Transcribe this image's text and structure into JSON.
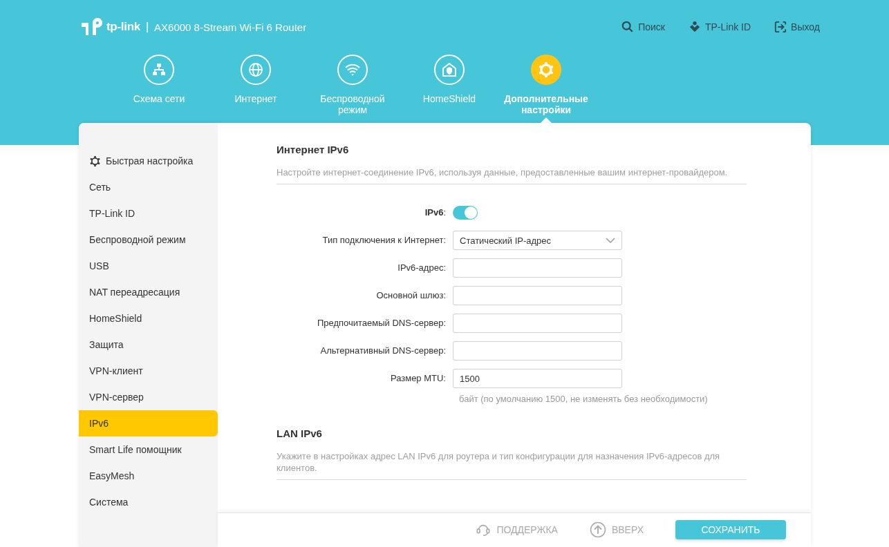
{
  "header": {
    "brand": "tp-link",
    "separator": "|",
    "product": "AX6000 8-Stream Wi-Fi 6 Router",
    "top_links": [
      {
        "label": "Поиск"
      },
      {
        "label": "TP-Link ID"
      },
      {
        "label": "Выход"
      }
    ],
    "nav": [
      {
        "label": "Схема сети",
        "selected": false
      },
      {
        "label": "Интернет",
        "selected": false
      },
      {
        "label": "Беспроводной режим",
        "selected": false
      },
      {
        "label": "HomeShield",
        "selected": false
      },
      {
        "label": "Дополнительные настройки",
        "selected": true
      }
    ]
  },
  "sidebar": {
    "items": [
      {
        "label": "Быстрая настройка",
        "selected": false
      },
      {
        "label": "Сеть",
        "selected": false
      },
      {
        "label": "TP-Link ID",
        "selected": false
      },
      {
        "label": "Беспроводной режим",
        "selected": false
      },
      {
        "label": "USB",
        "selected": false
      },
      {
        "label": "NAT переадресация",
        "selected": false
      },
      {
        "label": "HomeShield",
        "selected": false
      },
      {
        "label": "Защита",
        "selected": false
      },
      {
        "label": "VPN-клиент",
        "selected": false
      },
      {
        "label": "VPN-сервер",
        "selected": false
      },
      {
        "label": "IPv6",
        "selected": true
      },
      {
        "label": "Smart Life помощник",
        "selected": false
      },
      {
        "label": "EasyMesh",
        "selected": false
      },
      {
        "label": "Система",
        "selected": false
      }
    ]
  },
  "sections": [
    {
      "title": "Интернет IPv6",
      "description": "Настройте интернет-соединение IPv6, используя данные, предоставленные вашим интернет-провайдером.",
      "fields": [
        {
          "kind": "toggle",
          "label": "**IPv6**:",
          "on": true
        },
        {
          "kind": "select",
          "label": "Тип подключения к Интернет:",
          "value": "Статический IP-адрес"
        },
        {
          "kind": "input",
          "label": "IPv6-адрес:"
        },
        {
          "kind": "input",
          "label": "Основной шлюз:"
        },
        {
          "kind": "input",
          "label": "Предпочитаемый DNS-сервер:"
        },
        {
          "kind": "input",
          "label": "Альтернативный DNS-сервер:"
        },
        {
          "kind": "input",
          "label": "Размер MTU:",
          "value": "1500",
          "hint": "байт (по умолчанию 1500, не изменять без необходимости)"
        }
      ]
    },
    {
      "title": "LAN IPv6",
      "description": "Укажите в настройках адрес LAN IPv6 для роутера и тип конфигурации для назначения IPv6-адресов для клиентов."
    }
  ],
  "footer": {
    "support": "ПОДДЕРЖКА",
    "top": "ВВЕРХ",
    "save": "СОХРАНИТЬ"
  }
}
